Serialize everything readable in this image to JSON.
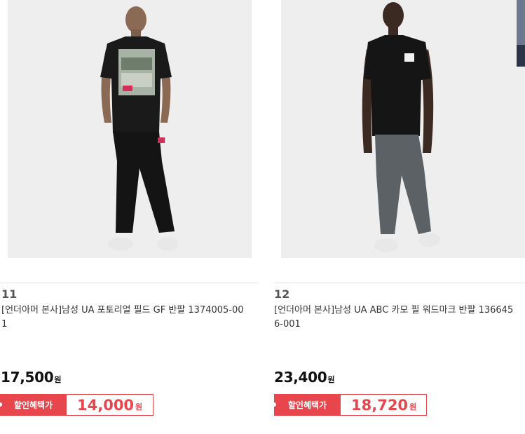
{
  "products": [
    {
      "rank": "11",
      "title": "[언더아머 본사]남성 UA 포토리얼 필드 GF 반팔 1374005-001",
      "price": "17,500",
      "price_unit": "원",
      "sale_label": "할인혜택가",
      "sale_price": "14,000",
      "sale_unit": "원",
      "image": "model-black-graphic-tee-black-joggers"
    },
    {
      "rank": "12",
      "title": "[언더아머 본사]남성 UA ABC 카모 필 워드마크 반팔 1366456-001",
      "price": "23,400",
      "price_unit": "원",
      "sale_label": "할인혜택가",
      "sale_price": "18,720",
      "sale_unit": "원",
      "image": "model-black-logo-tee-grey-joggers"
    }
  ],
  "colors": {
    "sale_red": "#e8464d",
    "image_bg": "#eeeeee",
    "price_text": "#111111"
  }
}
